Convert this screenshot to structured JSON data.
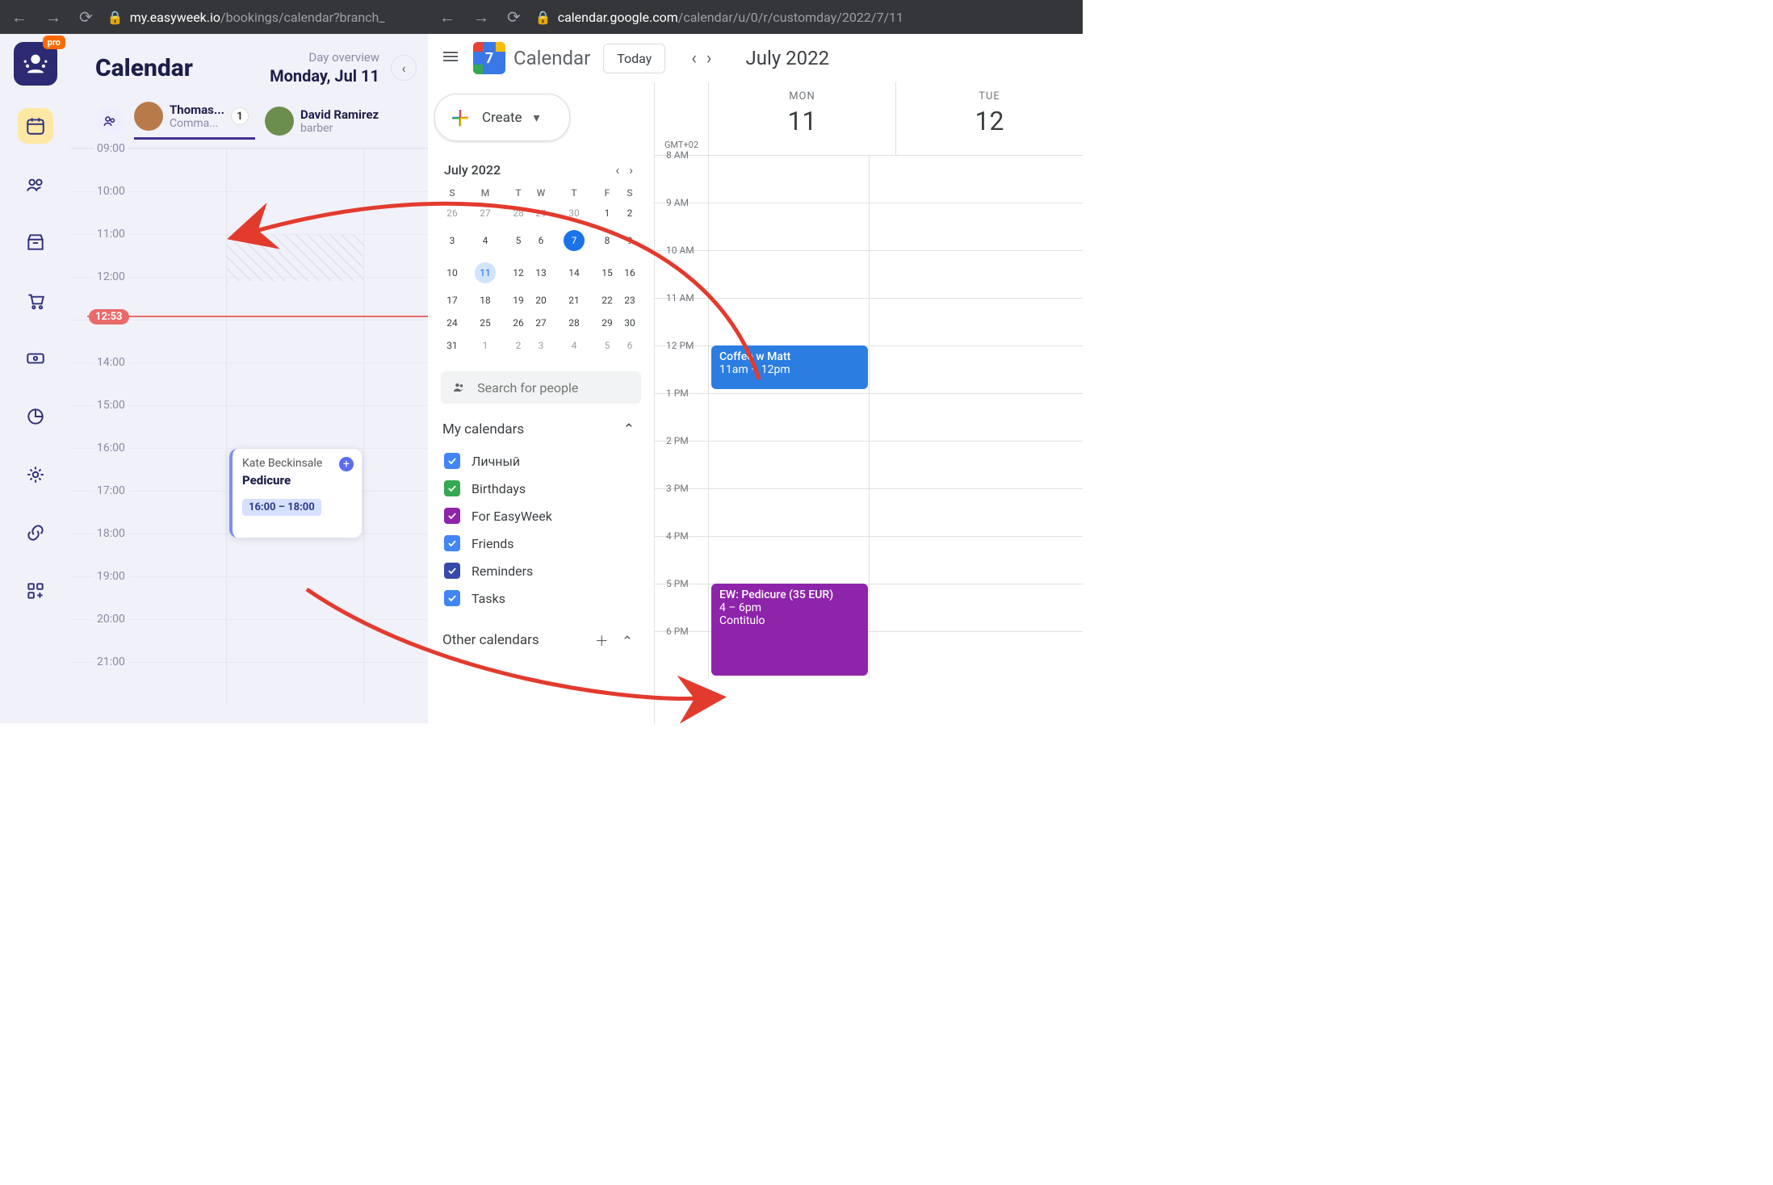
{
  "left": {
    "url_domain": "my.easyweek.io",
    "url_path": "/bookings/calendar?branch_",
    "logo_badge": "pro",
    "title": "Calendar",
    "overview_label": "Day overview",
    "date_label": "Monday, Jul 11",
    "staff": [
      {
        "name": "Thomas...",
        "role": "Comma...",
        "badge": "1"
      },
      {
        "name": "David Ramirez",
        "role": "barber"
      }
    ],
    "hours": [
      "09:00",
      "10:00",
      "11:00",
      "12:00",
      "",
      "14:00",
      "15:00",
      "16:00",
      "17:00",
      "18:00",
      "19:00",
      "20:00",
      "21:00"
    ],
    "now": "12:53",
    "appointment": {
      "client": "Kate Beckinsale",
      "service": "Pedicure",
      "time": "16:00 – 18:00"
    }
  },
  "right": {
    "url_domain": "calendar.google.com",
    "url_path": "/calendar/u/0/r/customday/2022/7/11",
    "brand": "Calendar",
    "brand_day": "7",
    "today_btn": "Today",
    "month_label": "July 2022",
    "create_label": "Create",
    "mini_month": "July 2022",
    "mini_dow": [
      "S",
      "M",
      "T",
      "W",
      "T",
      "F",
      "S"
    ],
    "mini_rows": [
      [
        {
          "d": "26",
          "g": 1
        },
        {
          "d": "27",
          "g": 1
        },
        {
          "d": "28",
          "g": 1
        },
        {
          "d": "29",
          "g": 1
        },
        {
          "d": "30",
          "g": 1
        },
        {
          "d": "1"
        },
        {
          "d": "2"
        }
      ],
      [
        {
          "d": "3"
        },
        {
          "d": "4"
        },
        {
          "d": "5"
        },
        {
          "d": "6"
        },
        {
          "d": "7",
          "today": 1
        },
        {
          "d": "8"
        },
        {
          "d": "9"
        }
      ],
      [
        {
          "d": "10"
        },
        {
          "d": "11",
          "sel": 1
        },
        {
          "d": "12"
        },
        {
          "d": "13"
        },
        {
          "d": "14"
        },
        {
          "d": "15"
        },
        {
          "d": "16"
        }
      ],
      [
        {
          "d": "17"
        },
        {
          "d": "18"
        },
        {
          "d": "19"
        },
        {
          "d": "20"
        },
        {
          "d": "21"
        },
        {
          "d": "22"
        },
        {
          "d": "23"
        }
      ],
      [
        {
          "d": "24"
        },
        {
          "d": "25"
        },
        {
          "d": "26"
        },
        {
          "d": "27"
        },
        {
          "d": "28"
        },
        {
          "d": "29"
        },
        {
          "d": "30"
        }
      ],
      [
        {
          "d": "31"
        },
        {
          "d": "1",
          "g": 1
        },
        {
          "d": "2",
          "g": 1
        },
        {
          "d": "3",
          "g": 1
        },
        {
          "d": "4",
          "g": 1
        },
        {
          "d": "5",
          "g": 1
        },
        {
          "d": "6",
          "g": 1
        }
      ]
    ],
    "search_placeholder": "Search for people",
    "mycal_label": "My calendars",
    "calendars": [
      {
        "label": "Личный",
        "color": "#4285f4"
      },
      {
        "label": "Birthdays",
        "color": "#34a853"
      },
      {
        "label": "For EasyWeek",
        "color": "#8e24aa"
      },
      {
        "label": "Friends",
        "color": "#4285f4"
      },
      {
        "label": "Reminders",
        "color": "#3949ab"
      },
      {
        "label": "Tasks",
        "color": "#4285f4"
      }
    ],
    "other_label": "Other calendars",
    "tz": "GMT+02",
    "days": [
      {
        "dw": "MON",
        "dn": "11"
      },
      {
        "dw": "TUE",
        "dn": "12"
      }
    ],
    "ghours": [
      "8 AM",
      "9 AM",
      "10 AM",
      "11 AM",
      "12 PM",
      "1 PM",
      "2 PM",
      "3 PM",
      "4 PM",
      "5 PM",
      "6 PM"
    ],
    "events": {
      "blue": {
        "title": "Coffee w Matt",
        "time": "11am – 12pm"
      },
      "purple": {
        "title": "EW: Pedicure (35 EUR)",
        "time": "4 – 6pm",
        "who": "Contitulo"
      }
    }
  }
}
